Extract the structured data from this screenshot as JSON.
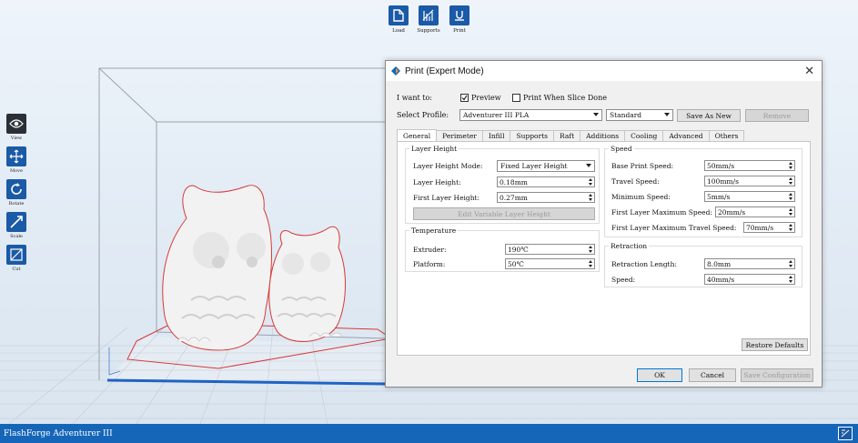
{
  "app": {
    "status_text": "FlashForge Adventurer III"
  },
  "top_toolbar": [
    {
      "id": "load",
      "label": "Load",
      "icon": "file-icon"
    },
    {
      "id": "supports",
      "label": "Supports",
      "icon": "supports-icon"
    },
    {
      "id": "print",
      "label": "Print",
      "icon": "print-icon"
    }
  ],
  "left_toolbar": [
    {
      "id": "view",
      "label": "View",
      "icon": "eye-icon",
      "active": true
    },
    {
      "id": "move",
      "label": "Move",
      "icon": "move-icon"
    },
    {
      "id": "rotate",
      "label": "Rotate",
      "icon": "rotate-icon"
    },
    {
      "id": "scale",
      "label": "Scale",
      "icon": "scale-icon"
    },
    {
      "id": "cut",
      "label": "Cut",
      "icon": "cut-icon"
    }
  ],
  "dialog": {
    "title": "Print (Expert Mode)",
    "i_want_to": "I want to:",
    "preview_label": "Preview",
    "preview_checked": true,
    "print_when_done_label": "Print When Slice Done",
    "print_when_done_checked": false,
    "select_profile_label": "Select Profile:",
    "profile_value": "Adventurer III PLA",
    "quality_value": "Standard",
    "save_as_new": "Save As New",
    "remove": "Remove",
    "tabs": [
      "General",
      "Perimeter",
      "Infill",
      "Supports",
      "Raft",
      "Additions",
      "Cooling",
      "Advanced",
      "Others"
    ],
    "active_tab": "General",
    "layer_height": {
      "legend": "Layer Height",
      "mode_label": "Layer Height Mode:",
      "mode_value": "Fixed Layer Height",
      "height_label": "Layer Height:",
      "height_value": "0.18mm",
      "first_label": "First Layer Height:",
      "first_value": "0.27mm",
      "edit_button": "Edit Variable Layer Height"
    },
    "temperature": {
      "legend": "Temperature",
      "extruder_label": "Extruder:",
      "extruder_value": "190℃",
      "platform_label": "Platform:",
      "platform_value": "50℃"
    },
    "speed": {
      "legend": "Speed",
      "base_label": "Base Print Speed:",
      "base_value": "50mm/s",
      "travel_label": "Travel Speed:",
      "travel_value": "100mm/s",
      "min_label": "Minimum Speed:",
      "min_value": "5mm/s",
      "first_max_label": "First Layer Maximum Speed:",
      "first_max_value": "20mm/s",
      "first_travel_label": "First Layer Maximum Travel Speed:",
      "first_travel_value": "70mm/s"
    },
    "retraction": {
      "legend": "Retraction",
      "length_label": "Retraction Length:",
      "length_value": "8.0mm",
      "speed_label": "Speed:",
      "speed_value": "40mm/s"
    },
    "restore_defaults": "Restore Defaults",
    "ok": "OK",
    "cancel": "Cancel",
    "save_configuration": "Save Configuration"
  },
  "colors": {
    "accent": "#1566b8",
    "icon_bg": "#1a5aa6",
    "platform_edge": "#1f63c4"
  }
}
